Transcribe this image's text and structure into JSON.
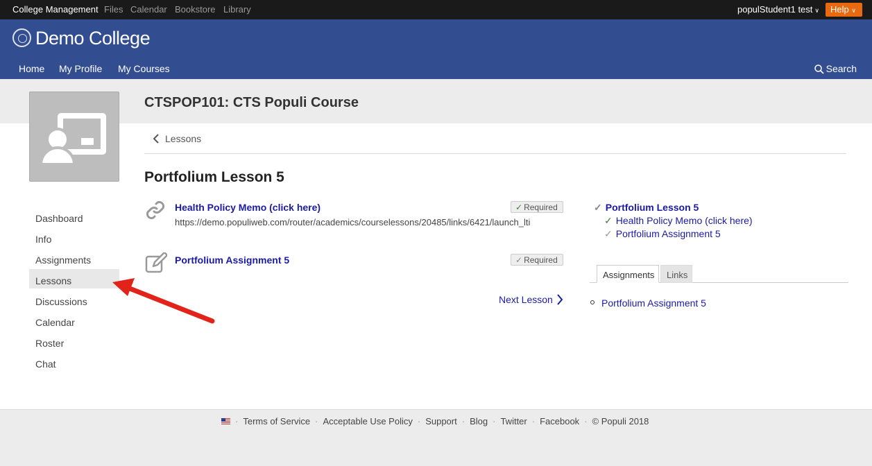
{
  "topbar": {
    "links": [
      "College Management",
      "Files",
      "Calendar",
      "Bookstore",
      "Library"
    ],
    "user": "populStudent1 test",
    "help": "Help"
  },
  "header": {
    "college_name": "Demo College",
    "nav": [
      "Home",
      "My Profile",
      "My Courses"
    ],
    "search": "Search"
  },
  "course": {
    "title": "CTSPOP101: CTS Populi Course"
  },
  "sidebar": {
    "items": [
      "Dashboard",
      "Info",
      "Assignments",
      "Lessons",
      "Discussions",
      "Calendar",
      "Roster",
      "Chat"
    ],
    "active": "Lessons"
  },
  "breadcrumb": "Lessons",
  "lesson": {
    "title": "Portfolium Lesson 5",
    "items": [
      {
        "title": "Health Policy Memo (click here)",
        "url": "https://demo.populiweb.com/router/academics/courselessons/20485/links/6421/launch_lti",
        "badge": "Required",
        "icon": "link-icon",
        "status": "done"
      },
      {
        "title": "Portfolium Assignment 5",
        "badge": "Required",
        "icon": "edit-icon",
        "status": "pending"
      }
    ],
    "next_label": "Next Lesson"
  },
  "outline": {
    "lesson": "Portfolium Lesson 5",
    "items": [
      "Health Policy Memo (click here)",
      "Portfolium Assignment 5"
    ]
  },
  "tabs": {
    "labels": [
      "Assignments",
      "Links"
    ],
    "active": "Assignments",
    "list": [
      "Portfolium Assignment 5"
    ]
  },
  "footer": {
    "links": [
      "Terms of Service",
      "Acceptable Use Policy",
      "Support",
      "Blog",
      "Twitter",
      "Facebook"
    ],
    "copyright": "© Populi 2018"
  },
  "colors": {
    "header": "#334d91",
    "help": "#e86a10",
    "link": "#1a1aa6",
    "check_done": "#3a7d3a",
    "annotation_arrow": "#e2231a"
  }
}
